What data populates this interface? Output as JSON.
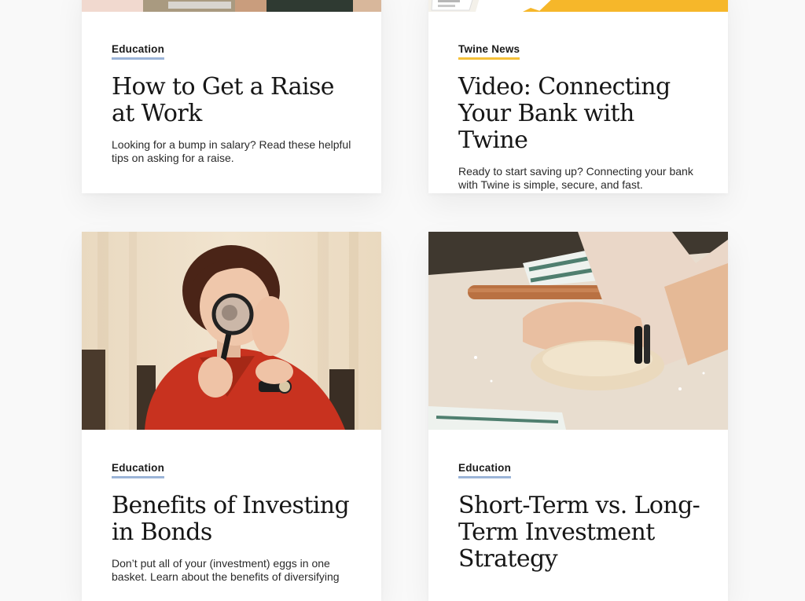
{
  "cards": [
    {
      "category": "Education",
      "title": "How to Get a Raise at Work",
      "description": "Looking for a bump in salary? Read these helpful tips on asking for a raise."
    },
    {
      "category": "Twine News",
      "title": "Video: Connecting Your Bank with Twine",
      "description": "Ready to start saving up? Connecting your bank with Twine is simple, secure, and fast."
    },
    {
      "category": "Education",
      "title": "Benefits of Investing in Bonds",
      "description": "Don’t put all of your (investment) eggs in one basket. Learn about the benefits of diversifying"
    },
    {
      "category": "Education",
      "title": "Short-Term vs. Long-Term Investment Strategy",
      "description": ""
    }
  ],
  "colors": {
    "education_underline": "#9bb4d8",
    "news_underline": "#f5c038",
    "page_background": "#f9f9f9"
  },
  "images": [
    "person-with-laptop-photo",
    "app-screens-yellow-photo",
    "woman-magnifying-glass-photo",
    "hands-kneading-dough-photo"
  ]
}
